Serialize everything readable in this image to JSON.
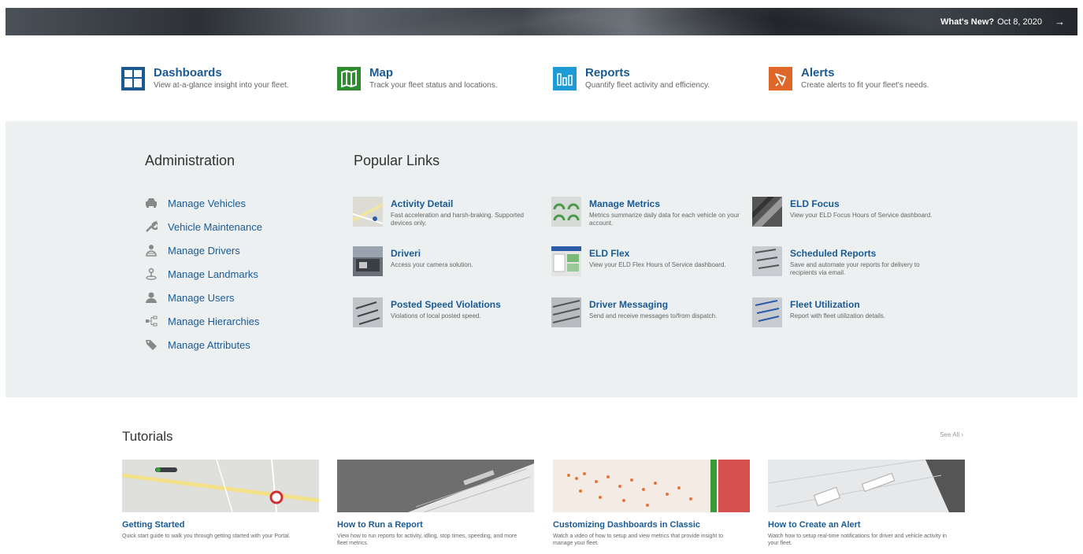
{
  "banner": {
    "whats_new_label": "What's New?",
    "whats_new_date": "Oct 8, 2020",
    "arrow": "→"
  },
  "quick_links": [
    {
      "title": "Dashboards",
      "desc": "View at-a-glance insight into your fleet.",
      "icon": "dashboard-icon",
      "color": "#1a5a94"
    },
    {
      "title": "Map",
      "desc": "Track your fleet status and locations.",
      "icon": "map-icon",
      "color": "#2e8b2e"
    },
    {
      "title": "Reports",
      "desc": "Quantify fleet activity and efficiency.",
      "icon": "reports-icon",
      "color": "#1e9bd7"
    },
    {
      "title": "Alerts",
      "desc": "Create alerts to fit your fleet's needs.",
      "icon": "alert-icon",
      "color": "#e0672a"
    }
  ],
  "administration": {
    "heading": "Administration",
    "items": [
      {
        "label": "Manage Vehicles",
        "icon": "car-icon"
      },
      {
        "label": "Vehicle Maintenance",
        "icon": "wrench-icon"
      },
      {
        "label": "Manage Drivers",
        "icon": "driver-icon"
      },
      {
        "label": "Manage Landmarks",
        "icon": "landmark-icon"
      },
      {
        "label": "Manage Users",
        "icon": "user-icon"
      },
      {
        "label": "Manage Hierarchies",
        "icon": "hierarchy-icon"
      },
      {
        "label": "Manage Attributes",
        "icon": "tag-icon"
      }
    ]
  },
  "popular": {
    "heading": "Popular Links",
    "items": [
      {
        "title": "Activity Detail",
        "desc": "Fast acceleration and harsh-braking. Supported devices only."
      },
      {
        "title": "Manage Metrics",
        "desc": "Metrics summarize daily data for each vehicle on your account."
      },
      {
        "title": "ELD Focus",
        "desc": "View your ELD Focus Hours of Service dashboard."
      },
      {
        "title": "Driveri",
        "desc": "Access your camera solution."
      },
      {
        "title": "ELD Flex",
        "desc": "View your ELD Flex Hours of Service dashboard."
      },
      {
        "title": "Scheduled Reports",
        "desc": "Save and automate your reports for delivery to recipients via email."
      },
      {
        "title": "Posted Speed Violations",
        "desc": "Violations of local posted speed."
      },
      {
        "title": "Driver Messaging",
        "desc": "Send and receive messages to/from dispatch."
      },
      {
        "title": "Fleet Utilization",
        "desc": "Report with fleet utilization details."
      }
    ]
  },
  "tutorials": {
    "heading": "Tutorials",
    "see_all": "See All ›",
    "items": [
      {
        "title": "Getting Started",
        "desc": "Quick start guide to walk you through getting started with your Portal."
      },
      {
        "title": "How to Run a Report",
        "desc": "View how to run reports for activity, idling, stop times, speeding, and more fleet metrics."
      },
      {
        "title": "Customizing Dashboards in Classic",
        "desc": "Watch a video of how to setup and view metrics that provide insight to manage your fleet."
      },
      {
        "title": "How to Create an Alert",
        "desc": "Watch how to setup real-time notifications for driver and vehicle activity in your fleet."
      }
    ]
  }
}
